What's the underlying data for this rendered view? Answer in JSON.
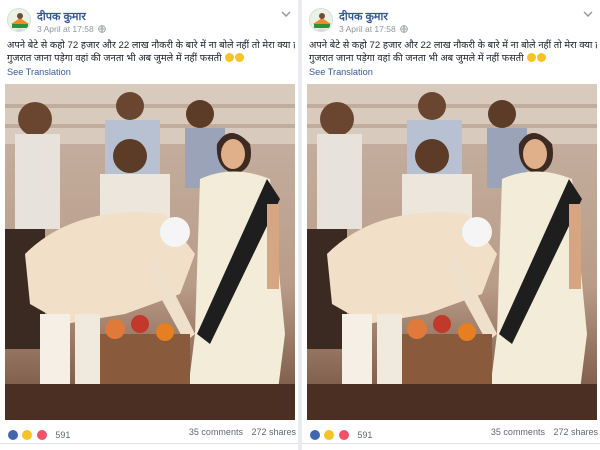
{
  "posts": [
    {
      "author": "दीपक कुमार",
      "date": "3 April at 17:58",
      "text_line1": "अपने बेटे से कहो 72 हजार और 22 लाख नौकरी के बारे में ना बोले नहीं तो मेरा क्या होगा",
      "text_line2": "गुजरात जाना पड़ेगा वहां की जनता भी अब जुमले में नहीं फसती",
      "see_translation": "See Translation",
      "reaction_count": "591",
      "comments": "35 comments",
      "shares": "272 shares"
    },
    {
      "author": "दीपक कुमार",
      "date": "3 April at 17:58",
      "text_line1": "अपने बेटे से कहो 72 हजार और 22 लाख नौकरी के बारे में ना बोले नहीं तो मेरा क्या होगा",
      "text_line2": "गुजरात जाना पड़ेगा वहां की जनता भी अब जुमले में नहीं फसती",
      "see_translation": "See Translation",
      "reaction_count": "591",
      "comments": "35 comments",
      "shares": "272 shares"
    }
  ],
  "icons": {
    "privacy": "globe-icon",
    "menu": "chevron-down-icon",
    "reactions": [
      "like-icon",
      "haha-icon",
      "love-icon"
    ]
  },
  "colors": {
    "link": "#365899",
    "meta": "#90949c",
    "text": "#1d2129",
    "like": "#4267b2",
    "haha": "#f7c325",
    "love": "#f25268"
  }
}
